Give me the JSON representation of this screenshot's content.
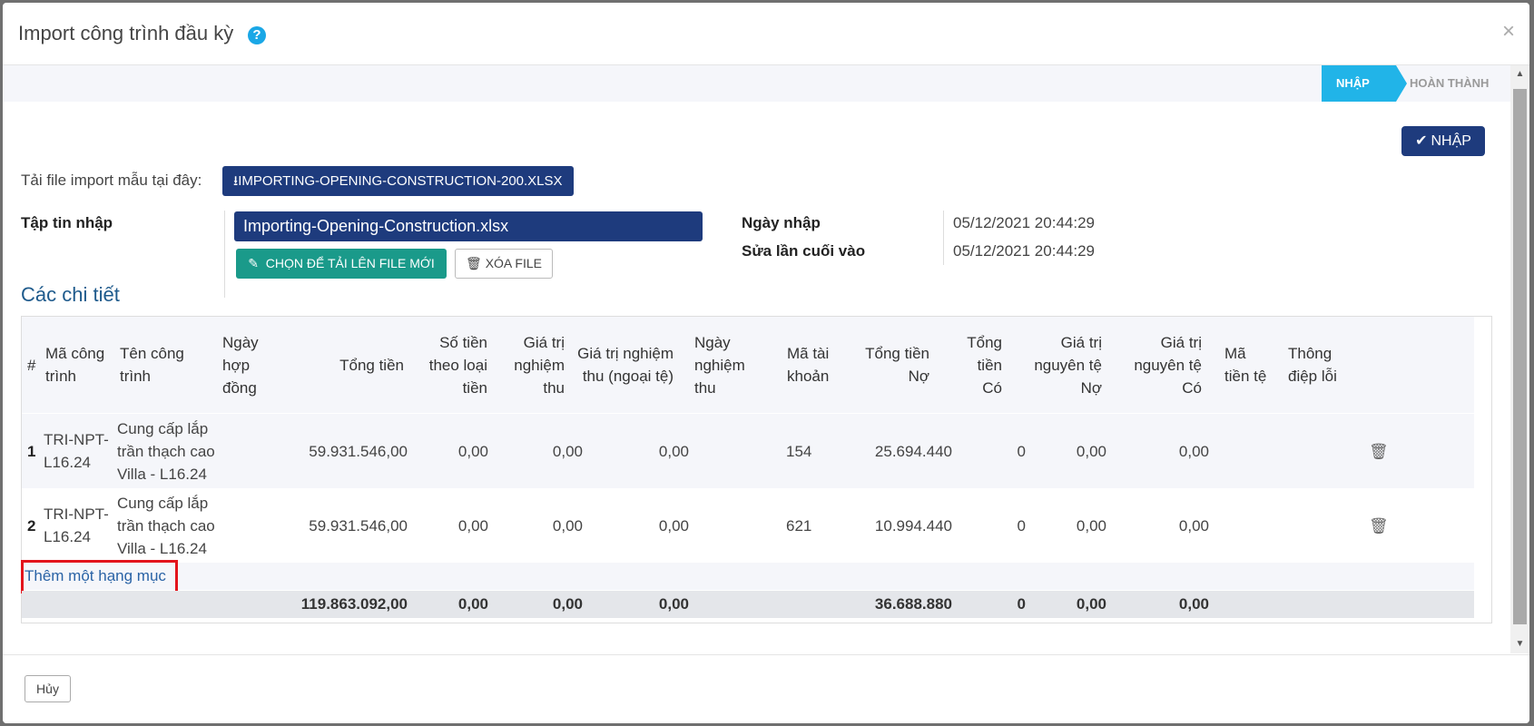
{
  "modal": {
    "title": "Import công trình đầu kỳ",
    "help_glyph": "?",
    "close_glyph": "×"
  },
  "steps": {
    "active": "NHẬP",
    "inactive": "HOÀN THÀNH"
  },
  "actions": {
    "import_label": "NHẬP"
  },
  "template": {
    "label": "Tải file import mẫu tại đây:",
    "download_label": "IMPORTING-OPENING-CONSTRUCTION-200.XLSX"
  },
  "file": {
    "label": "Tập tin nhập",
    "name": "Importing-Opening-Construction.xlsx",
    "upload_label": "CHỌN ĐỂ TẢI LÊN FILE MỚI",
    "remove_label": "XÓA FILE"
  },
  "meta": {
    "import_date_label": "Ngày nhập",
    "import_date": "05/12/2021 20:44:29",
    "modified_label": "Sửa lần cuối vào",
    "modified_date": "05/12/2021 20:44:29"
  },
  "details": {
    "title": "Các chi tiết",
    "columns": {
      "index": "#",
      "code": "Mã công trình",
      "name": "Tên công trình",
      "contract_date": "Ngày hợp đồng",
      "total": "Tổng tiền",
      "amount_by_type": "Số tiền theo loại tiền",
      "acceptance_value": "Giá trị nghiệm thu",
      "acceptance_value_fc": "Giá trị nghiệm thu (ngoại tệ)",
      "acceptance_date": "Ngày nghiệm thu",
      "account": "Mã tài khoản",
      "total_debit": "Tổng tiền Nợ",
      "total_credit": "Tổng tiền Có",
      "orig_debit": "Giá trị nguyên tệ Nợ",
      "orig_credit": "Giá trị nguyên tệ Có",
      "currency": "Mã tiền tệ",
      "error": "Thông điệp lỗi"
    },
    "rows": [
      {
        "index": "1",
        "code": "TRI-NPT-L16.24",
        "name": "Cung cấp lắp trần thạch cao Villa - L16.24",
        "contract_date": "",
        "total": "59.931.546,00",
        "amount_by_type": "0,00",
        "acceptance_value": "0,00",
        "acceptance_value_fc": "0,00",
        "acceptance_date": "",
        "account": "154",
        "total_debit": "25.694.440",
        "total_credit": "0",
        "orig_debit": "0,00",
        "orig_credit": "0,00",
        "currency": "",
        "error": ""
      },
      {
        "index": "2",
        "code": "TRI-NPT-L16.24",
        "name": "Cung cấp lắp trần thạch cao Villa - L16.24",
        "contract_date": "",
        "total": "59.931.546,00",
        "amount_by_type": "0,00",
        "acceptance_value": "0,00",
        "acceptance_value_fc": "0,00",
        "acceptance_date": "",
        "account": "621",
        "total_debit": "10.994.440",
        "total_credit": "0",
        "orig_debit": "0,00",
        "orig_credit": "0,00",
        "currency": "",
        "error": ""
      }
    ],
    "add_label": "Thêm một hạng mục",
    "totals": {
      "total": "119.863.092,00",
      "amount_by_type": "0,00",
      "acceptance_value": "0,00",
      "acceptance_value_fc": "0,00",
      "total_debit": "36.688.880",
      "total_credit": "0",
      "orig_debit": "0,00",
      "orig_credit": "0,00"
    }
  },
  "footer": {
    "cancel_label": "Hủy"
  },
  "colors": {
    "primary": "#1e3b7d",
    "step_active": "#21b4e8",
    "upload_button": "#1a9a8a",
    "highlight": "#e3141c",
    "link": "#2a63a6"
  }
}
